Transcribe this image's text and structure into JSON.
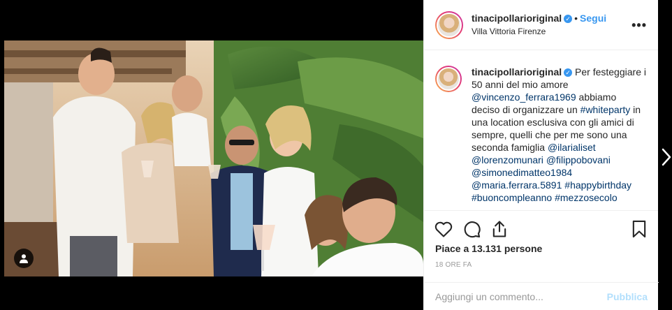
{
  "post": {
    "author": {
      "username": "tinacipollarioriginal",
      "verified_icon": "verified-badge-icon",
      "location": "Villa Vittoria Firenze"
    },
    "header": {
      "separator": "•",
      "follow_label": "Segui",
      "more_icon": "•••"
    },
    "caption": {
      "username": "tinacipollarioriginal",
      "parts": {
        "t1": "Per festeggiare i 50 anni del mio amore ",
        "m1": "@vincenzo_ferrara1969",
        "t2": " abbiamo deciso di organizzare un ",
        "h1": "#whiteparty",
        "t3": " in una location esclusiva con gli amici di sempre, quelli che per me sono una seconda famiglia ",
        "m2": "@ilarialiset",
        "m3": "@lorenzomunari",
        "m4": "@filippobovani",
        "m5": "@simonedimatteo1984",
        "m6": "@maria.ferrara.5891",
        "h2": "#happybirthday",
        "h3": "#buoncompleanno",
        "h4": "#mezzosecolo"
      }
    },
    "likes": {
      "text": "Piace a 13.131 persone"
    },
    "timestamp": "18 ORE FA",
    "comment": {
      "placeholder": "Aggiungi un commento...",
      "publish_label": "Pubblica"
    },
    "icons": {
      "like": "heart-icon",
      "comment": "comment-icon",
      "share": "share-icon",
      "save": "bookmark-icon",
      "user_tags": "user-tag-icon",
      "next": "chevron-right-icon"
    },
    "colors": {
      "link": "#003569",
      "follow": "#3897f0",
      "publish_disabled": "#b2dffc",
      "backdrop": "#000000"
    }
  }
}
